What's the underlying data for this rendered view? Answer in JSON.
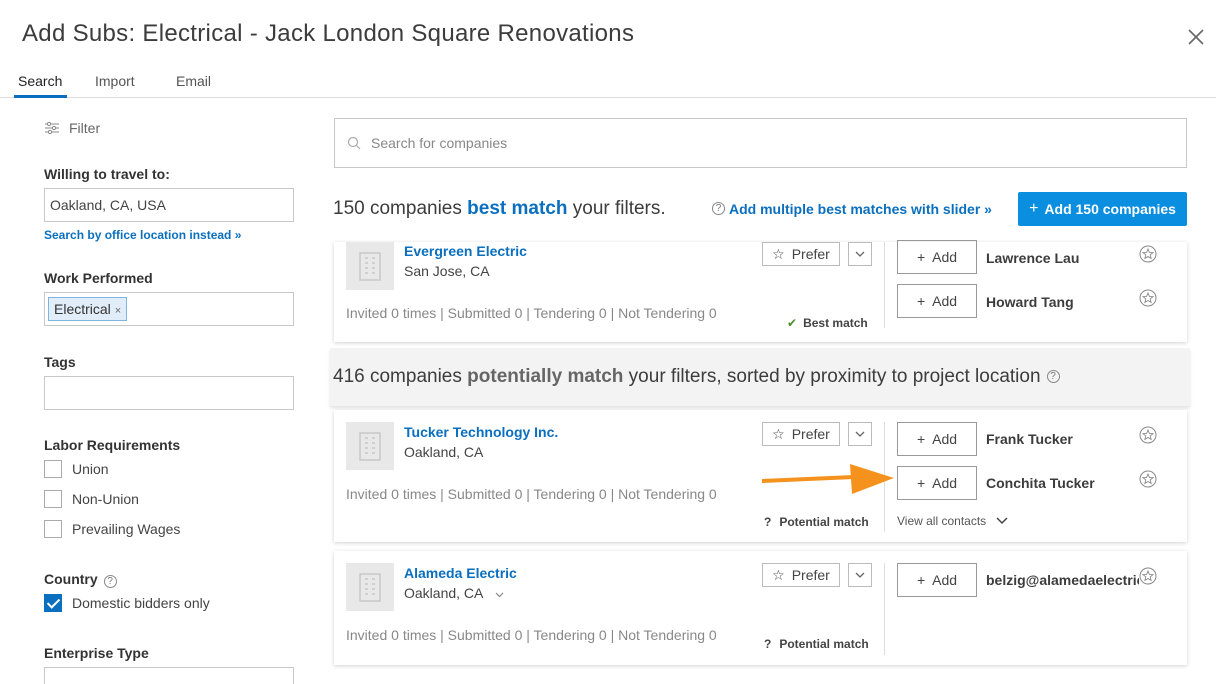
{
  "header": {
    "title": "Add Subs: Electrical - Jack London Square Renovations",
    "close_icon": "close-icon"
  },
  "tabs": [
    {
      "label": "Search",
      "active": true
    },
    {
      "label": "Import",
      "active": false
    },
    {
      "label": "Email",
      "active": false
    }
  ],
  "sidebar": {
    "filter_label": "Filter",
    "travel_label": "Willing to travel to:",
    "travel_value": "Oakland, CA, USA",
    "office_link": "Search by office location instead »",
    "work_label": "Work Performed",
    "work_chip": "Electrical",
    "chip_remove": "×",
    "tags_label": "Tags",
    "labor_label": "Labor Requirements",
    "labor_options": [
      {
        "label": "Union",
        "checked": false
      },
      {
        "label": "Non-Union",
        "checked": false
      },
      {
        "label": "Prevailing Wages",
        "checked": false
      }
    ],
    "country_label": "Country",
    "country_option": {
      "label": "Domestic bidders only",
      "checked": true
    },
    "enterprise_label": "Enterprise Type"
  },
  "main": {
    "search_placeholder": "Search for companies",
    "best": {
      "prefix": "150 companies ",
      "highlight": "best match",
      "suffix": " your filters.",
      "multi_link": "Add multiple best matches with slider »",
      "add_all": "Add 150 companies"
    },
    "potential": {
      "prefix": "416 companies ",
      "highlight": "potentially match",
      "suffix": " your filters, sorted by proximity to project location"
    },
    "prefer_label": "Prefer",
    "add_label": "Add",
    "view_all": "View all contacts",
    "companies": [
      {
        "name": "Evergreen Electric",
        "location": "San Jose, CA",
        "stats": "Invited 0 times | Submitted 0 | Tendering 0 | Not Tendering 0",
        "match": "Best match",
        "contacts": [
          "Lawrence Lau",
          "Howard Tang"
        ]
      },
      {
        "name": "Tucker Technology Inc.",
        "location": "Oakland, CA",
        "stats": "Invited 0 times | Submitted 0 | Tendering 0 | Not Tendering 0",
        "match": "Potential match",
        "contacts": [
          "Frank Tucker",
          "Conchita Tucker"
        ]
      },
      {
        "name": "Alameda Electric",
        "location": "Oakland, CA",
        "stats": "Invited 0 times | Submitted 0 | Tendering 0 | Not Tendering 0",
        "match": "Potential match",
        "contacts": [
          "belzig@alamedaelectric"
        ]
      }
    ],
    "colors": {
      "accent": "#0a6fbf",
      "button": "#0a8ee0",
      "arrow": "#f5921e"
    }
  }
}
